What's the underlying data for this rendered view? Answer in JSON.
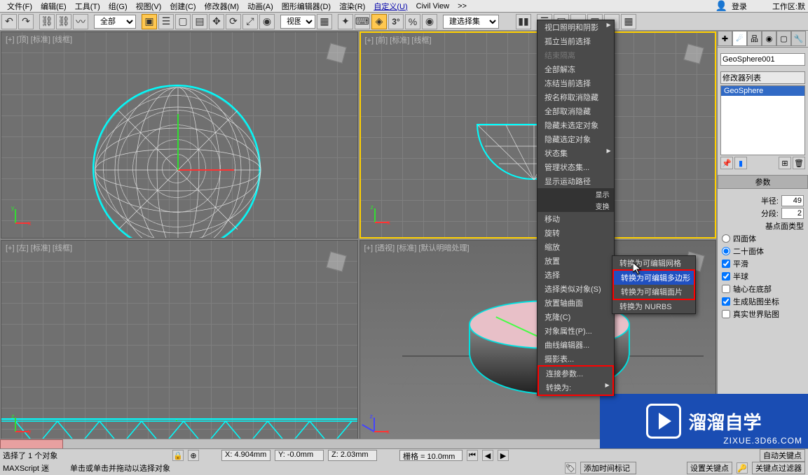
{
  "menubar": {
    "items": [
      "文件(F)",
      "编辑(E)",
      "工具(T)",
      "组(G)",
      "视图(V)",
      "创建(C)",
      "修改器(M)",
      "动画(A)",
      "图形编辑器(D)",
      "渲染(R)",
      "自定义(U)",
      "Civil View",
      ">>"
    ],
    "login": "登录",
    "workspace_label": "工作区:",
    "workspace_value": "默"
  },
  "toolbar": {
    "all_label": "全部",
    "view_label": "视图",
    "selection_set": "建选择集"
  },
  "viewports": {
    "top": {
      "label": "[+] [顶] [标准] [线框]"
    },
    "front": {
      "label": "[+] [前] [标准] [线框]"
    },
    "left": {
      "label": "[+] [左] [标准] [线框]"
    },
    "perspective": {
      "label": "[+] [透视] [标准] [默认明暗处理]"
    }
  },
  "context_menu": {
    "items": [
      {
        "label": "视口照明和阴影",
        "sub": true
      },
      {
        "label": "孤立当前选择"
      },
      {
        "label": "结束隔离",
        "disabled": true
      },
      {
        "label": "全部解冻"
      },
      {
        "label": "冻结当前选择"
      },
      {
        "label": "按名称取消隐藏"
      },
      {
        "label": "全部取消隐藏"
      },
      {
        "label": "隐藏未选定对象"
      },
      {
        "label": "隐藏选定对象"
      },
      {
        "label": "状态集",
        "sub": true
      },
      {
        "label": "管理状态集..."
      },
      {
        "label": "显示运动路径"
      }
    ],
    "header_display": "显示",
    "header_transform": "变换",
    "items2": [
      {
        "label": "移动"
      },
      {
        "label": "旋转"
      },
      {
        "label": "缩放"
      },
      {
        "label": "放置"
      },
      {
        "label": "选择"
      },
      {
        "label": "选择类似对象(S)"
      },
      {
        "label": "放置轴曲面"
      },
      {
        "label": "克隆(C)"
      },
      {
        "label": "对象属性(P)..."
      },
      {
        "label": "曲线编辑器..."
      },
      {
        "label": "摄影表..."
      },
      {
        "label": "连接参数...",
        "highlight": true
      },
      {
        "label": "转换为:",
        "sub": true,
        "highlight": true
      }
    ],
    "submenu": [
      {
        "label": "转换为可编辑网格"
      },
      {
        "label": "转换为可编辑多边形",
        "hover": true
      },
      {
        "label": "转换为可编辑面片"
      },
      {
        "label": "转换为 NURBS"
      }
    ]
  },
  "cmd_panel": {
    "object_name": "GeoSphere001",
    "modifier_label": "修改器列表",
    "stack_item": "GeoSphere",
    "rollout_params": "参数",
    "radius_label": "半径:",
    "radius_value": "49",
    "segments_label": "分段:",
    "segments_value": "2",
    "base_type_label": "基点面类型",
    "tetra": "四面体",
    "icosa": "二十面体",
    "smooth": "平滑",
    "hemisphere": "半球",
    "axis_bottom": "轴心在底部",
    "gen_mapping": "生成贴图坐标",
    "real_world": "真实世界贴图"
  },
  "status": {
    "selection_info": "选择了 1 个对象",
    "prompt": "单击或单击并拖动以选择对象",
    "maxscript": "MAXScript 迷",
    "x": "X: 4.904mm",
    "y": "Y: -0.0mm",
    "z": "Z: 2.03mm",
    "grid": "栅格 = 10.0mm",
    "add_time_tag": "添加时间标记",
    "auto_key": "自动关键点",
    "set_key": "设置关键点",
    "key_filter": "关键点过滤器"
  },
  "watermark": {
    "text": "溜溜自学",
    "url": "ZIXUE.3D66.COM"
  }
}
